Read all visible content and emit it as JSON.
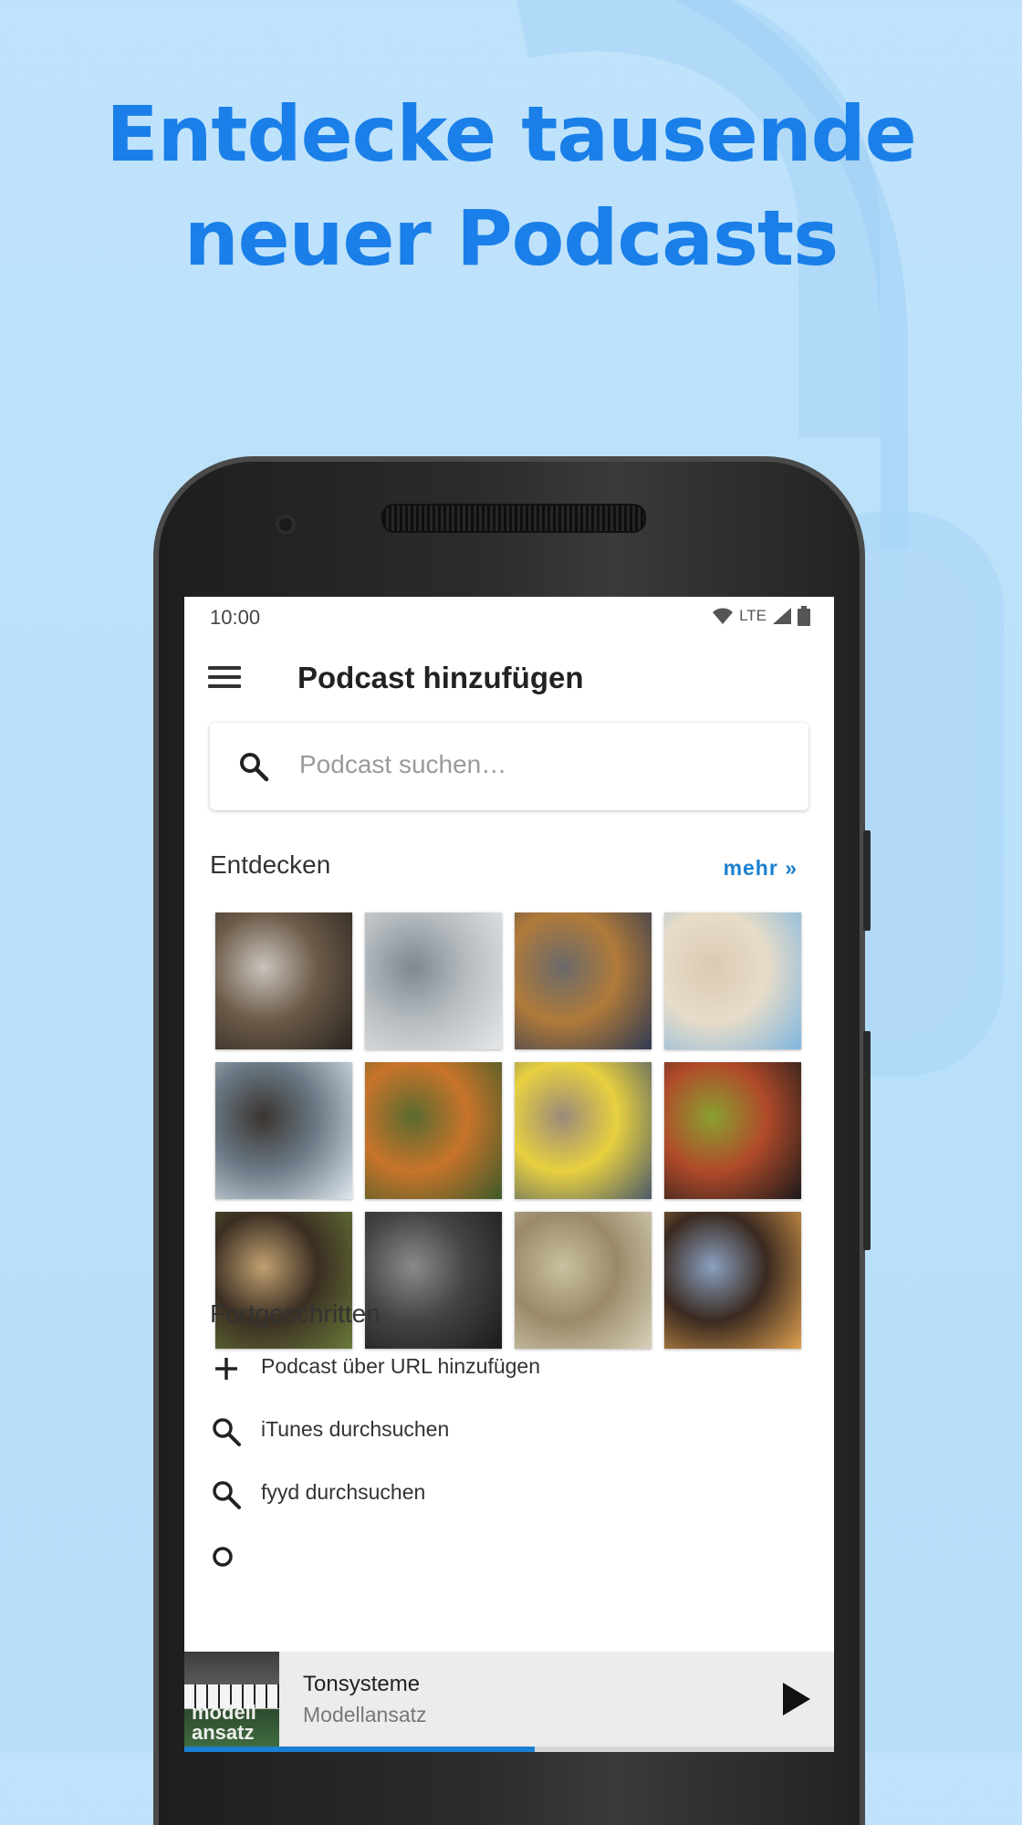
{
  "headline": {
    "line1": "Entdecke tausende",
    "line2": "neuer Podcasts"
  },
  "status_bar": {
    "time": "10:00",
    "network": "LTE"
  },
  "app_bar": {
    "title": "Podcast hinzufügen",
    "menu_icon": "hamburger-menu-icon"
  },
  "search": {
    "placeholder": "Podcast suchen…",
    "icon": "search-icon"
  },
  "discover": {
    "title": "Entdecken",
    "more_label": "mehr »",
    "tiles": [
      {
        "subject": "woman reading",
        "colors": [
          "#2a2520",
          "#6b5a48",
          "#c9c3bb"
        ]
      },
      {
        "subject": "snowy forest",
        "colors": [
          "#e6e8ea",
          "#b6bcc0",
          "#7e8890"
        ]
      },
      {
        "subject": "hands with camera",
        "colors": [
          "#2e3a52",
          "#b07a3a",
          "#6a6a6a"
        ]
      },
      {
        "subject": "beach",
        "colors": [
          "#7fb6e0",
          "#e8dcc8",
          "#d9cab2"
        ]
      },
      {
        "subject": "waves on rocks",
        "colors": [
          "#dfe7ee",
          "#6b7a86",
          "#3a3430"
        ]
      },
      {
        "subject": "autumn forest aerial",
        "colors": [
          "#3c5a2a",
          "#c8742a",
          "#5a6a30"
        ]
      },
      {
        "subject": "yellow flower on wood",
        "colors": [
          "#4a5a6a",
          "#e8d040",
          "#9a8a7a"
        ]
      },
      {
        "subject": "colorful leaves",
        "colors": [
          "#1a1a1a",
          "#b04a2a",
          "#8aa030"
        ]
      },
      {
        "subject": "mossy log",
        "colors": [
          "#6a7a3a",
          "#3a2e22",
          "#c0a070"
        ]
      },
      {
        "subject": "vintage cameras",
        "colors": [
          "#1a1a1a",
          "#444444",
          "#8a8a8a"
        ]
      },
      {
        "subject": "deer in field",
        "colors": [
          "#d8d0b8",
          "#9a8a6a",
          "#c8c0a0"
        ]
      },
      {
        "subject": "sunset puddle road",
        "colors": [
          "#e0a050",
          "#3a2a20",
          "#8aa0c0"
        ]
      }
    ]
  },
  "advanced": {
    "title": "Fortgeschritten",
    "items": [
      {
        "icon": "plus-icon",
        "label": "Podcast über URL hinzufügen"
      },
      {
        "icon": "search-icon",
        "label": "iTunes durchsuchen"
      },
      {
        "icon": "search-icon",
        "label": "fyyd durchsuchen"
      }
    ]
  },
  "player": {
    "title": "Tonsysteme",
    "subtitle": "Modellansatz",
    "cover_text_line1": "modell",
    "cover_text_line2": "ansatz",
    "progress": 0.54
  }
}
